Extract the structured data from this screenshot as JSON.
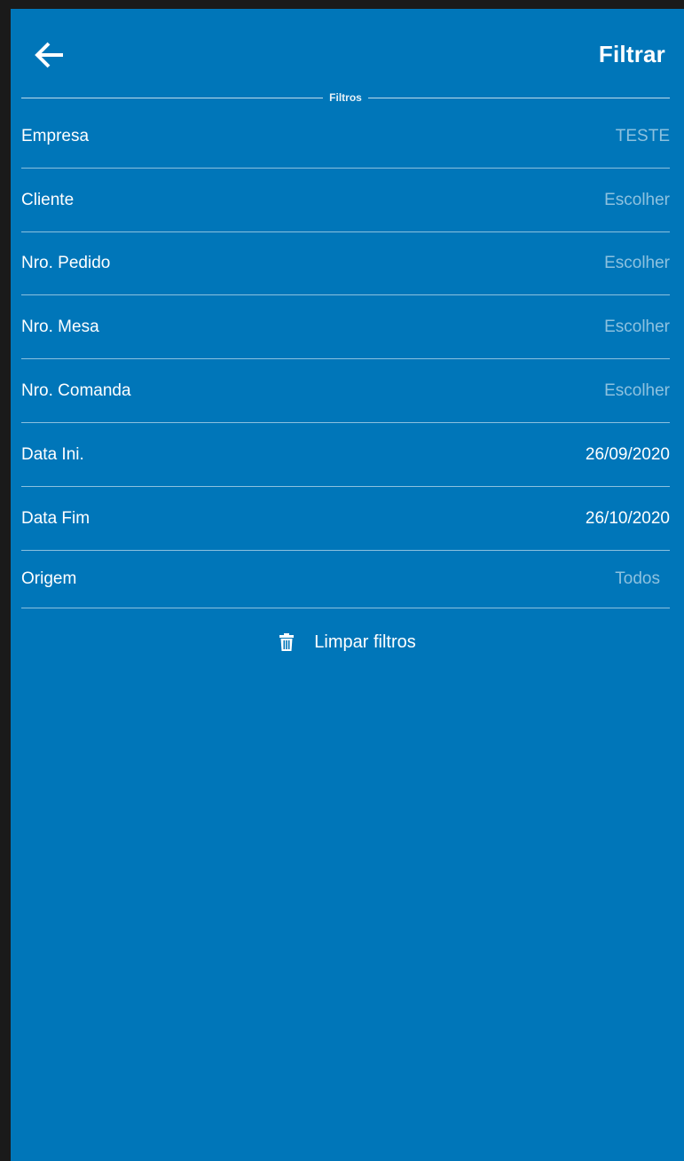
{
  "header": {
    "back_icon": "arrow-left-icon",
    "action_label": "Filtrar"
  },
  "section": {
    "title": "Filtros"
  },
  "filters": [
    {
      "label": "Empresa",
      "value": "TESTE",
      "state": "placeholder"
    },
    {
      "label": "Cliente",
      "value": "Escolher",
      "state": "placeholder"
    },
    {
      "label": "Nro. Pedido",
      "value": "Escolher",
      "state": "placeholder"
    },
    {
      "label": "Nro. Mesa",
      "value": "Escolher",
      "state": "placeholder"
    },
    {
      "label": "Nro. Comanda",
      "value": "Escolher",
      "state": "placeholder"
    },
    {
      "label": "Data Ini.",
      "value": "26/09/2020",
      "state": "filled"
    },
    {
      "label": "Data Fim",
      "value": "26/10/2020",
      "state": "filled"
    },
    {
      "label": "Origem",
      "value": "Todos",
      "state": "placeholder"
    }
  ],
  "clear": {
    "icon": "trash-icon",
    "label": "Limpar filtros"
  },
  "colors": {
    "background": "#0076b9",
    "text": "#ffffff",
    "placeholder": "rgba(255,255,255,0.55)"
  }
}
